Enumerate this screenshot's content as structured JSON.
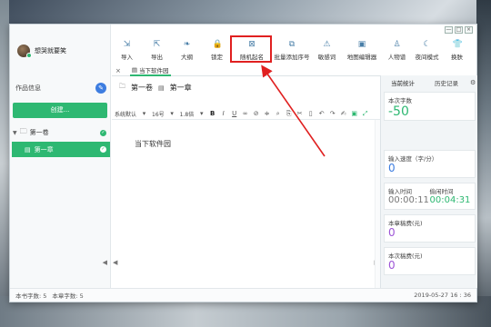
{
  "titlebar": {
    "minimize": "—",
    "maximize": "□",
    "close": "×"
  },
  "user": {
    "name": "想哭就要笑"
  },
  "sidebar": {
    "works_label": "作品信息",
    "create_label": "创建...",
    "volume_label": "第一卷",
    "chapter_label": "第一章"
  },
  "toolbar": {
    "items": [
      {
        "label": "导入",
        "icon": "import-icon"
      },
      {
        "label": "导出",
        "icon": "export-icon"
      },
      {
        "label": "大纲",
        "icon": "outline-icon"
      },
      {
        "label": "锁定",
        "icon": "lock-icon"
      },
      {
        "label": "随机起名",
        "icon": "random-name-icon"
      },
      {
        "label": "批量添加序号",
        "icon": "batch-number-icon"
      },
      {
        "label": "敏感词",
        "icon": "warning-icon"
      },
      {
        "label": "地图编辑器",
        "icon": "map-icon"
      },
      {
        "label": "人物谱",
        "icon": "person-icon"
      },
      {
        "label": "夜间模式",
        "icon": "moon-icon"
      },
      {
        "label": "换肤",
        "icon": "shirt-icon"
      }
    ]
  },
  "tabs": {
    "close": "×",
    "doc_tab": "当下软件园"
  },
  "breadcrumb": {
    "volume": "第一卷",
    "chapter": "第一章"
  },
  "format": {
    "font": "系统默认",
    "size": "16号",
    "line_height": "1.8倍"
  },
  "editor": {
    "text": "当下软件园"
  },
  "panel": {
    "tab_today": "当前统计",
    "tab_history": "历史记录",
    "words_label": "本次字数",
    "words_value": "-50",
    "speed_label": "输入速度（字/分）",
    "speed_value": "0",
    "input_time_label": "输入时间",
    "input_time_value": "00:00:11",
    "idle_time_label": "偷闲时间",
    "idle_time_value": "00:04:31",
    "chapter_summary_label": "本章稿费(元)",
    "chapter_summary_value": "0",
    "session_summary_label": "本次稿费(元)",
    "session_summary_value": "0"
  },
  "status": {
    "book_words": "本书字数: 5",
    "chapter_words": "本章字数: 5",
    "datetime": "2019-05-27 16 : 36"
  },
  "colors": {
    "accent": "#2eb872",
    "highlight": "#e02020",
    "blue": "#3d7de0"
  }
}
